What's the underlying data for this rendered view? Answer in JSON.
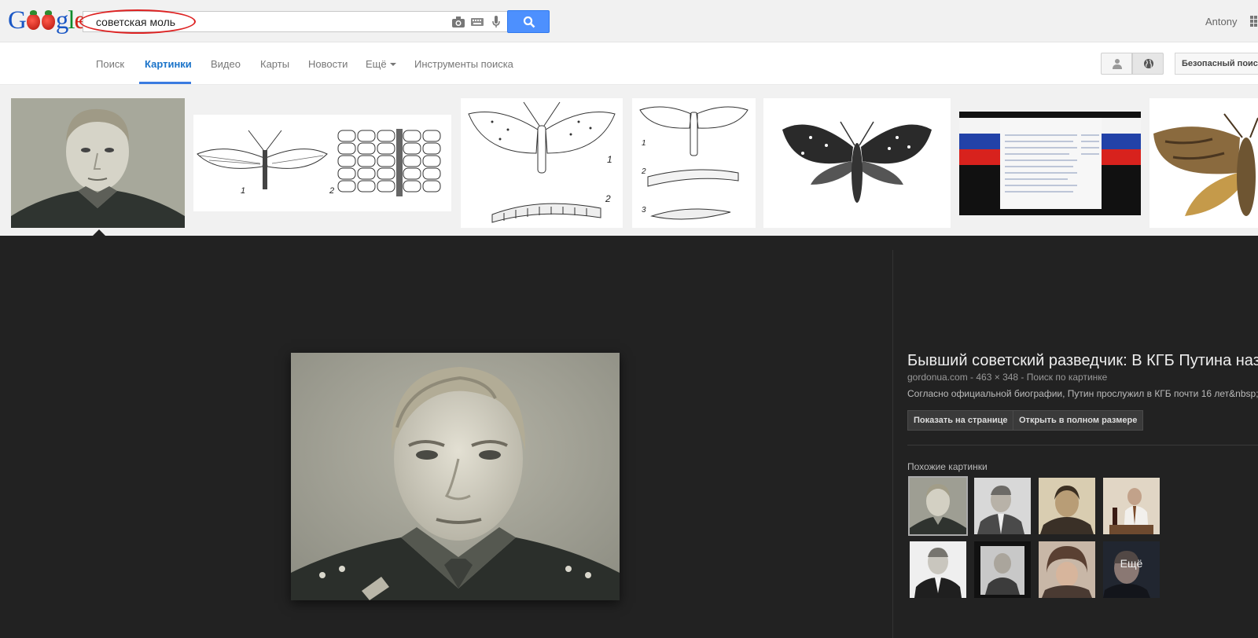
{
  "header": {
    "logo_text": "Google",
    "search_query": "советская моль",
    "user_name": "Antony",
    "colors": {
      "accent": "#4d90fe",
      "active_tab": "#1a73c9",
      "query_highlight": "#d22222"
    }
  },
  "nav": {
    "tabs": [
      {
        "label": "Поиск"
      },
      {
        "label": "Картинки"
      },
      {
        "label": "Видео"
      },
      {
        "label": "Карты"
      },
      {
        "label": "Новости"
      },
      {
        "label": "Ещё"
      },
      {
        "label": "Инструменты поиска"
      }
    ],
    "active_tab": "Картинки",
    "safe_search_label": "Безопасный поиск"
  },
  "thumbnails": [
    {
      "icon": "portrait-photo"
    },
    {
      "icon": "moth-drawing-with-eggs"
    },
    {
      "icon": "moth-and-larva-drawing"
    },
    {
      "icon": "moth-lifecycle-drawing"
    },
    {
      "icon": "moth-ink-drawing"
    },
    {
      "icon": "russian-flag-document"
    },
    {
      "icon": "brown-moth-photo"
    }
  ],
  "preview": {
    "title": "Бывший советский разведчик: В КГБ Путина наз",
    "meta": "gordonua.com - 463 × 348 - Поиск по картинке",
    "description": "Согласно официальной биографии, Путин прослужил в КГБ почти 16 лет&nbsp;&n",
    "visit_button": "Показать на странице",
    "full_size_button": "Открыть в полном размере",
    "related_label": "Похожие картинки",
    "more_label": "Ещё"
  }
}
